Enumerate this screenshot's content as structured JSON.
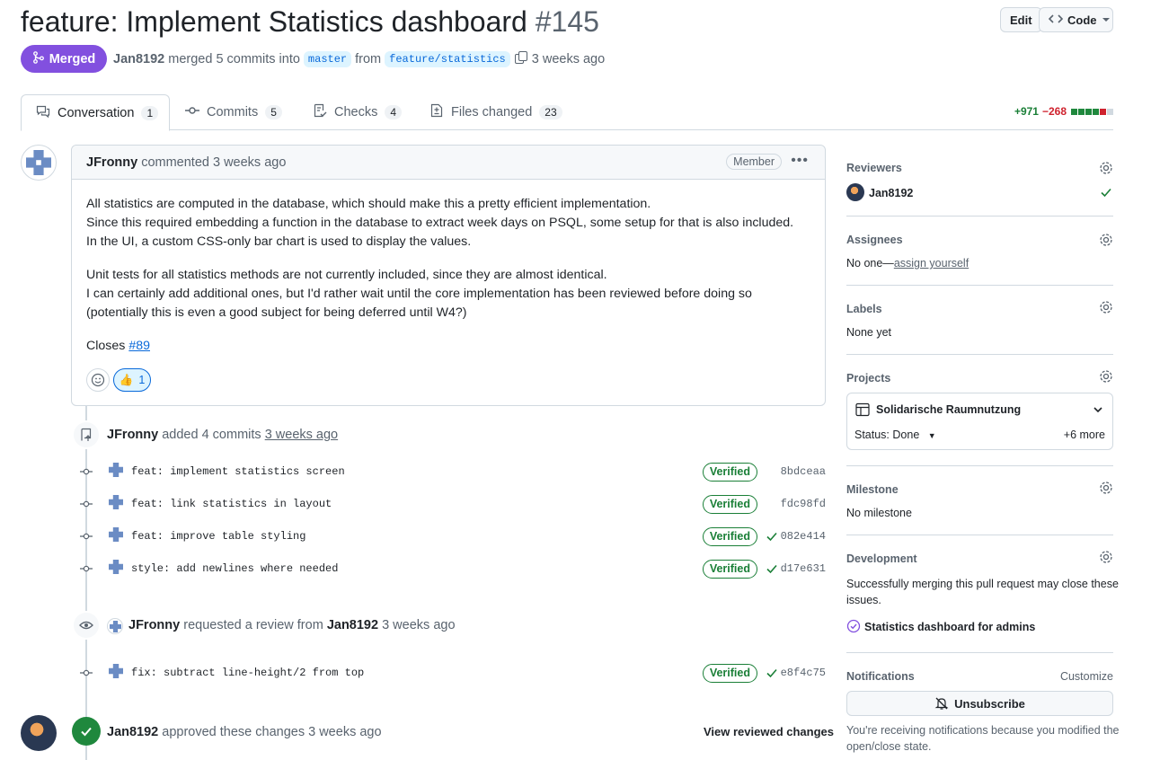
{
  "header": {
    "title": "feature: Implement Statistics dashboard",
    "number": "#145",
    "edit_label": "Edit",
    "code_label": "Code",
    "status_label": "Merged",
    "merger": "Jan8192",
    "merged_text": "merged 5 commits into",
    "base_branch": "master",
    "from_text": "from",
    "head_branch": "feature/statistics",
    "time": "3 weeks ago"
  },
  "tabs": [
    {
      "label": "Conversation",
      "count": "1",
      "icon": "comment-discussion-icon"
    },
    {
      "label": "Commits",
      "count": "5",
      "icon": "git-commit-icon"
    },
    {
      "label": "Checks",
      "count": "4",
      "icon": "checklist-icon"
    },
    {
      "label": "Files changed",
      "count": "23",
      "icon": "file-diff-icon"
    }
  ],
  "diffstat": {
    "additions": "+971",
    "deletions": "−268",
    "blocks": [
      "#1f883d",
      "#1f883d",
      "#1f883d",
      "#1f883d",
      "#cf222e"
    ]
  },
  "comment": {
    "author": "JFronny",
    "action": "commented 3 weeks ago",
    "role": "Member",
    "paragraphs": [
      [
        "All statistics are computed in the database, which should make this a pretty efficient implementation.",
        "Since this required embedding a function in the database to extract week days on PSQL, some setup for that is also included.",
        "In the UI, a custom CSS-only bar chart is used to display the values."
      ],
      [
        "Unit tests for all statistics methods are not currently included, since they are almost identical.",
        "I can certainly add additional ones, but I'd rather wait until the core implementation has been reviewed before doing so",
        "(potentially this is even a good subject for being deferred until W4?)"
      ]
    ],
    "closes_label": "Closes",
    "closes_link": "#89",
    "reaction_emoji": "👍",
    "reaction_count": "1"
  },
  "timeline": {
    "commits_event": {
      "author": "JFronny",
      "text": "added 4 commits",
      "time": "3 weeks ago"
    },
    "commits": [
      {
        "message": "feat: implement statistics screen",
        "verified": "Verified",
        "sha": "8bdceaa",
        "check": false
      },
      {
        "message": "feat: link statistics in layout",
        "verified": "Verified",
        "sha": "fdc98fd",
        "check": false
      },
      {
        "message": "feat: improve table styling",
        "verified": "Verified",
        "sha": "082e414",
        "check": true
      },
      {
        "message": "style: add newlines where needed",
        "verified": "Verified",
        "sha": "d17e631",
        "check": true
      }
    ],
    "review_request": {
      "author": "JFronny",
      "text": "requested a review from",
      "reviewer": "Jan8192",
      "time": "3 weeks ago"
    },
    "late_commit": {
      "message": "fix: subtract line-height/2 from top",
      "verified": "Verified",
      "sha": "e8f4c75",
      "check": true
    },
    "approval": {
      "author": "Jan8192",
      "text": "approved these changes 3 weeks ago",
      "view_label": "View reviewed changes"
    }
  },
  "sidebar": {
    "reviewers": {
      "title": "Reviewers",
      "name": "Jan8192"
    },
    "assignees": {
      "title": "Assignees",
      "none": "No one—",
      "link": "assign yourself"
    },
    "labels": {
      "title": "Labels",
      "value": "None yet"
    },
    "projects": {
      "title": "Projects",
      "name": "Solidarische Raumnutzung",
      "status": "Status: Done",
      "more": "+6 more"
    },
    "milestone": {
      "title": "Milestone",
      "value": "No milestone"
    },
    "development": {
      "title": "Development",
      "text_line1": "Successfully merging this pull request may close these",
      "text_line2": "issues.",
      "issue": "Statistics dashboard for admins"
    },
    "notifications": {
      "title": "Notifications",
      "customize": "Customize",
      "button": "Unsubscribe",
      "note_line1": "You're receiving notifications because you modified the",
      "note_line2": "open/close state."
    }
  }
}
